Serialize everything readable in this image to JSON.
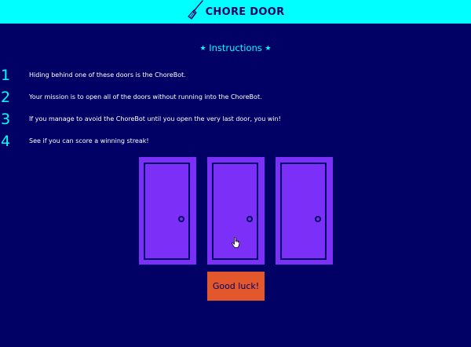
{
  "header": {
    "title": "CHORE DOOR",
    "logo_icon": "broom-icon",
    "background_color": "#00ffff"
  },
  "instructions": {
    "heading": "Instructions",
    "heading_star": "★",
    "items": [
      {
        "number": "1",
        "text": "Hiding behind one of these doors is the ChoreBot."
      },
      {
        "number": "2",
        "text": "Your mission is to open all of the doors without running into the ChoreBot."
      },
      {
        "number": "3",
        "text": "If you manage to avoid the ChoreBot until you open the very last door, you win!"
      },
      {
        "number": "4",
        "text": "See if you can score a winning streak!"
      }
    ]
  },
  "doors": {
    "count": 3,
    "state": "closed",
    "color": "#7b2ff7"
  },
  "start_button": {
    "label": "Good luck!",
    "color": "#e2572c"
  },
  "colors": {
    "page_background": "#010165",
    "accent": "#00ffff",
    "text": "#ffffff"
  }
}
